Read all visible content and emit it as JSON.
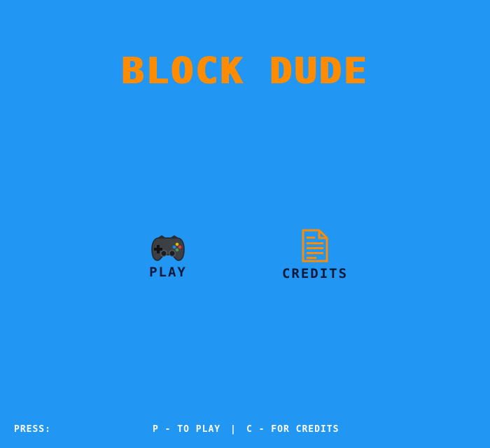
{
  "game": {
    "title": "BLOCK DUDE"
  },
  "menu": {
    "play": {
      "label": "PLAY",
      "icon": "gamepad-icon"
    },
    "credits": {
      "label": "CREDITS",
      "icon": "document-icon"
    }
  },
  "footer": {
    "press_label": "PRESS:",
    "play_hint": "P - TO PLAY",
    "separator": "|",
    "credits_hint": "C - FOR CREDITS"
  },
  "colors": {
    "background": "#2196f3",
    "title": "#ff8c00",
    "menu_text": "#0b1a3a",
    "footer_text": "#ffffff"
  }
}
